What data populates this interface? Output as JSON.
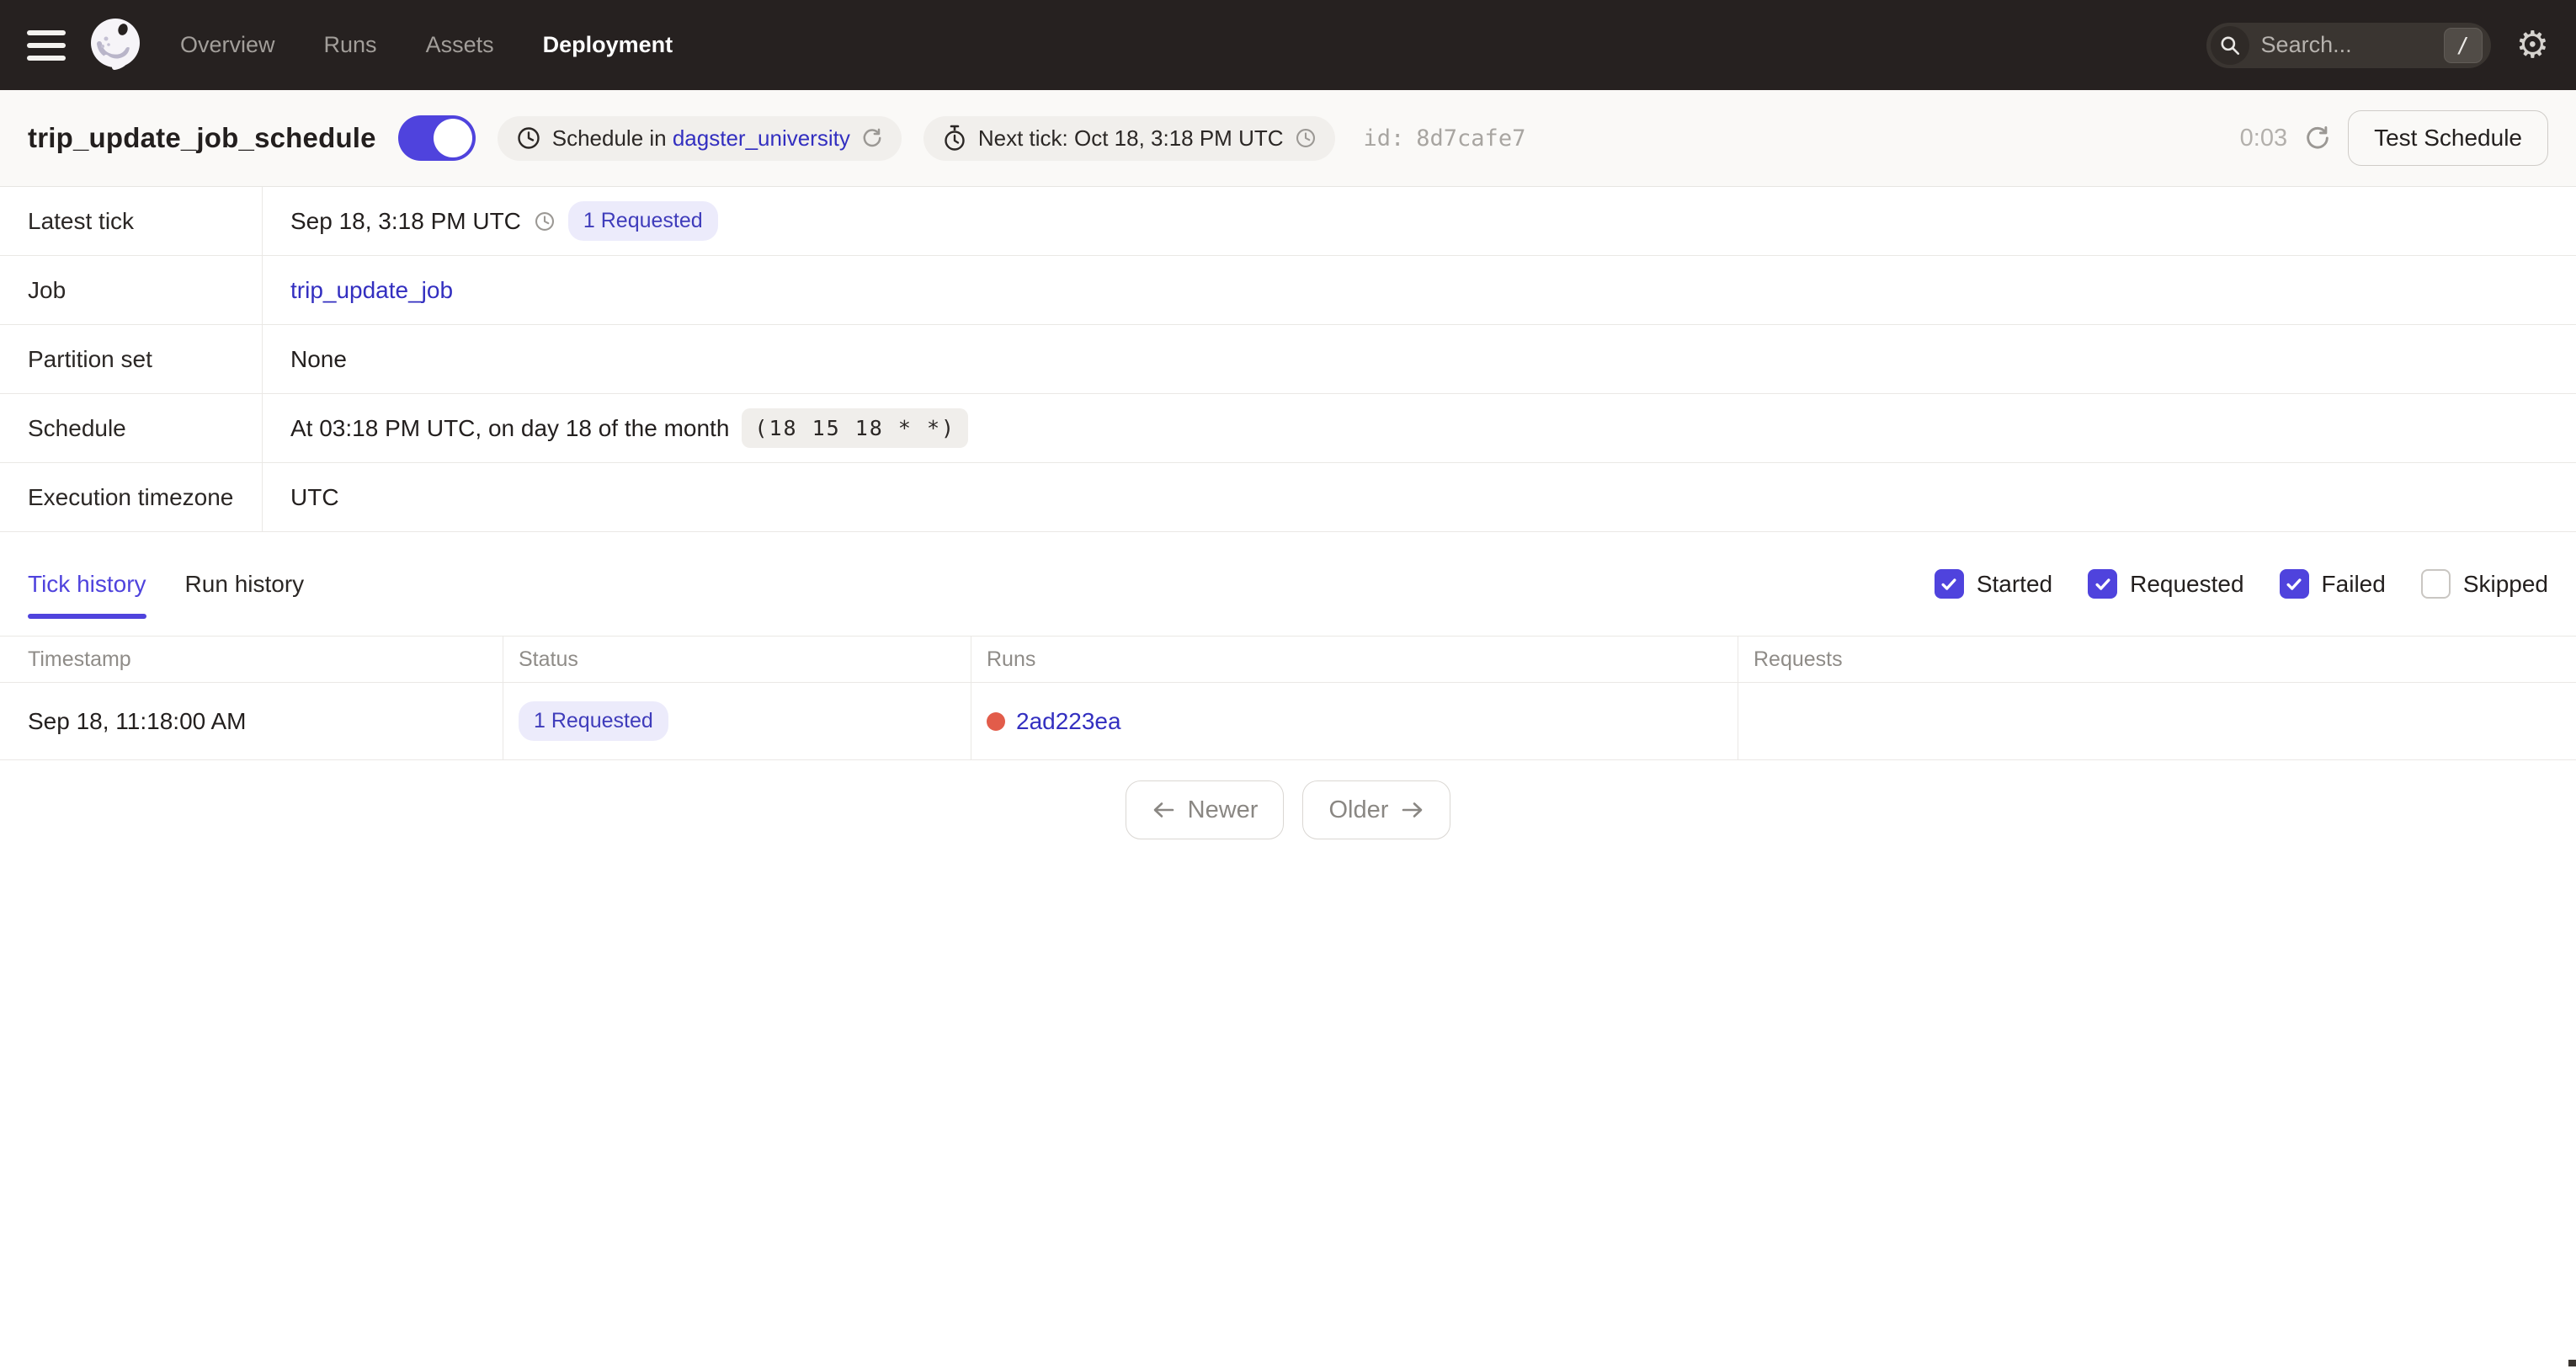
{
  "nav": {
    "items": [
      {
        "label": "Overview",
        "active": false
      },
      {
        "label": "Runs",
        "active": false
      },
      {
        "label": "Assets",
        "active": false
      },
      {
        "label": "Deployment",
        "active": true
      }
    ],
    "search": {
      "placeholder": "Search...",
      "shortcut": "/"
    }
  },
  "icons": {
    "gear": "⚙"
  },
  "header": {
    "title": "trip_update_job_schedule",
    "toggle_on": true,
    "schedule_pill": {
      "prefix": "Schedule in ",
      "link": "dagster_university"
    },
    "next_tick": "Next tick: Oct 18, 3:18 PM UTC",
    "id_label": "id:",
    "id_value": "8d7cafe7",
    "countdown": "0:03",
    "test_button": "Test Schedule"
  },
  "details": {
    "rows": [
      {
        "label": "Latest tick",
        "value": "Sep 18, 3:18 PM UTC",
        "badge": "1 Requested"
      },
      {
        "label": "Job",
        "link": "trip_update_job"
      },
      {
        "label": "Partition set",
        "value": "None"
      },
      {
        "label": "Schedule",
        "value": "At 03:18 PM UTC, on day 18 of the month",
        "cron": "(18 15 18 * *)"
      },
      {
        "label": "Execution timezone",
        "value": "UTC"
      }
    ]
  },
  "tabs": [
    {
      "label": "Tick history",
      "active": true
    },
    {
      "label": "Run history",
      "active": false
    }
  ],
  "filters": [
    {
      "label": "Started",
      "checked": true
    },
    {
      "label": "Requested",
      "checked": true
    },
    {
      "label": "Failed",
      "checked": true
    },
    {
      "label": "Skipped",
      "checked": false
    }
  ],
  "tick_table": {
    "headers": [
      "Timestamp",
      "Status",
      "Runs",
      "Requests"
    ],
    "rows": [
      {
        "timestamp": "Sep 18, 11:18:00 AM",
        "status_badge": "1 Requested",
        "run_link": "2ad223ea",
        "run_status": "failed",
        "requests": ""
      }
    ]
  },
  "pagination": {
    "newer": "Newer",
    "older": "Older"
  },
  "colors": {
    "accent_indigo": "#4F43DD",
    "link": "#332FC0",
    "badge_bg": "#ECEBFB",
    "badge_text": "#3F3CBB",
    "run_failed_red": "#E25C4A",
    "nav_bg": "#262120",
    "titlebar_bg": "#FAF9F7",
    "border": "#EAE8E5"
  }
}
